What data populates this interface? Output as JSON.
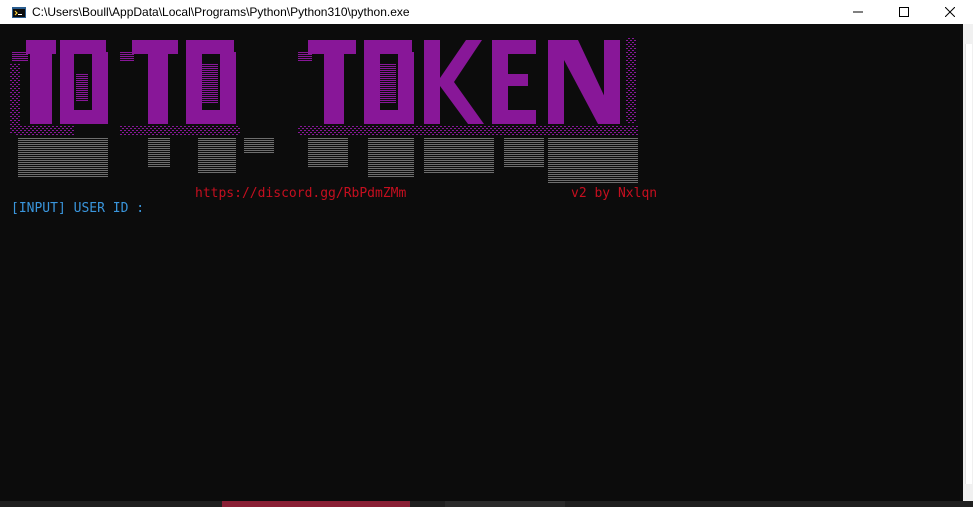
{
  "window": {
    "title": "C:\\Users\\Boull\\AppData\\Local\\Programs\\Python\\Python310\\python.exe",
    "icon": "python-console-icon",
    "controls": [
      "minimize-icon",
      "maximize-icon",
      "close-icon"
    ]
  },
  "banner": {
    "text": "ID TO TOKEN",
    "color": "#881798",
    "style": "ascii-art-dripping"
  },
  "console": {
    "invite_link": "https://discord.gg/RbPdmZMm",
    "version_text": "v2 by Nxlqn",
    "prompt": "[INPUT] USER ID :",
    "colors": {
      "link": "#c50f1f",
      "version": "#c50f1f",
      "prompt": "#3a96dd",
      "background": "#0c0c0c"
    }
  }
}
